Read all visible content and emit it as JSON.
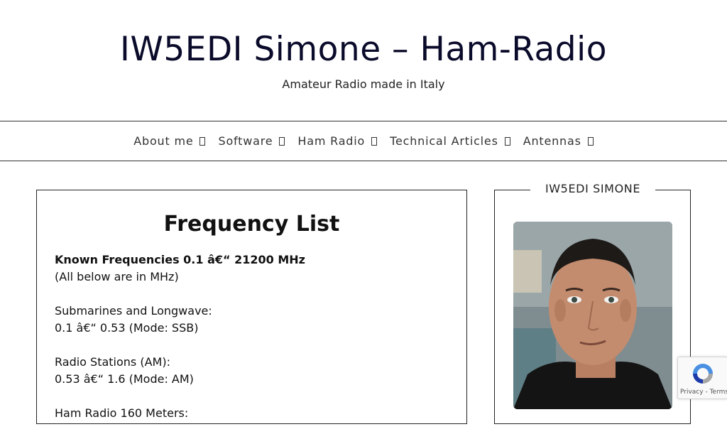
{
  "header": {
    "title": "IW5EDI Simone – Ham-Radio",
    "tagline": "Amateur Radio made in Italy"
  },
  "nav": {
    "items": [
      {
        "label": "About me"
      },
      {
        "label": "Software"
      },
      {
        "label": "Ham Radio"
      },
      {
        "label": "Technical Articles"
      },
      {
        "label": "Antennas"
      }
    ]
  },
  "article": {
    "title": "Frequency List",
    "intro_bold": "Known Frequencies 0.1 â€“ 21200 MHz",
    "intro_note": "(All below are in MHz)",
    "sections": [
      {
        "heading": "Submarines and Longwave:",
        "line": "0.1 â€“ 0.53 (Mode: SSB)"
      },
      {
        "heading": "Radio Stations (AM):",
        "line": "0.53 â€“ 1.6 (Mode: AM)"
      }
    ],
    "cutoff_line": "Ham Radio 160 Meters:"
  },
  "sidebar": {
    "widget_title": "IW5EDI SIMONE"
  },
  "recaptcha": {
    "privacy": "Privacy",
    "separator": " - ",
    "terms": "Terms"
  }
}
